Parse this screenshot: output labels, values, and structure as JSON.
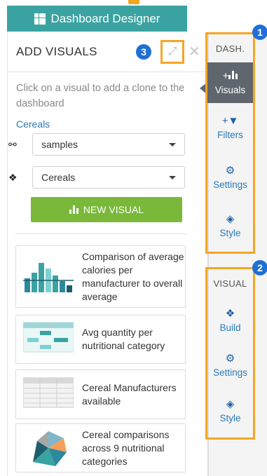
{
  "header": {
    "title": "Dashboard Designer"
  },
  "panel": {
    "title": "ADD VISUALS",
    "hint": "Click on a visual to add a clone to the dashboard",
    "dataset_link": "Cereals",
    "dataset_select": "samples",
    "table_select": "Cereals",
    "new_visual_label": "NEW VISUAL"
  },
  "cards": [
    {
      "label": "Comparison of average calories per manufacturer to overall average"
    },
    {
      "label": "Avg quantity per nutritional category"
    },
    {
      "label": "Cereal Manufacturers available"
    },
    {
      "label": "Cereal comparisons across 9 nutritional categories"
    }
  ],
  "rail": {
    "dash_head": "DASH.",
    "dash_items": [
      {
        "label": "Visuals",
        "icon": "plus-bar-chart-icon"
      },
      {
        "label": "Filters",
        "icon": "plus-filter-icon"
      },
      {
        "label": "Settings",
        "icon": "gears-icon"
      },
      {
        "label": "Style",
        "icon": "diamond-icon"
      }
    ],
    "visual_head": "VISUAL",
    "visual_items": [
      {
        "label": "Build",
        "icon": "cogs-icon"
      },
      {
        "label": "Settings",
        "icon": "gears-icon"
      },
      {
        "label": "Style",
        "icon": "diamond-icon"
      }
    ]
  },
  "badges": {
    "b1": "1",
    "b2": "2",
    "b3": "3"
  },
  "colors": {
    "header": "#3aa3a1",
    "accent_green": "#7ab83a",
    "highlight": "#f5a623",
    "badge": "#1f6fd6",
    "link": "#2a7ab8"
  }
}
